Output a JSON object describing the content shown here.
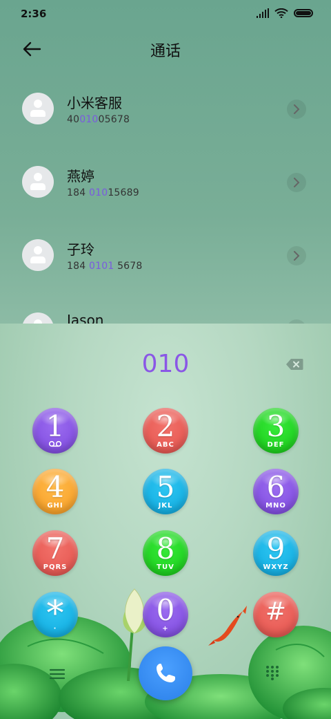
{
  "status_bar": {
    "time": "2:36"
  },
  "header": {
    "title": "通话"
  },
  "contacts": [
    {
      "name": "小米客服",
      "number_pre": "40",
      "number_hl": "010",
      "number_post": "05678"
    },
    {
      "name": "燕婷",
      "number_pre": "184 ",
      "number_hl": "010",
      "number_post": "15689"
    },
    {
      "name": "子玲",
      "number_pre": "184 ",
      "number_hl": "0101",
      "number_post": " 5678"
    },
    {
      "name": "Jason",
      "number_pre": "",
      "number_hl": "",
      "number_post": ""
    }
  ],
  "dialer": {
    "input": "010",
    "keys": [
      {
        "digit": "1",
        "letters": "",
        "color": "#8752e4"
      },
      {
        "digit": "2",
        "letters": "ABC",
        "color": "#ea5e58"
      },
      {
        "digit": "3",
        "letters": "DEF",
        "color": "#22d822"
      },
      {
        "digit": "4",
        "letters": "GHI",
        "color": "#f9aa34"
      },
      {
        "digit": "5",
        "letters": "JKL",
        "color": "#18b4e6"
      },
      {
        "digit": "6",
        "letters": "MNO",
        "color": "#8752e4"
      },
      {
        "digit": "7",
        "letters": "PQRS",
        "color": "#ea5e58"
      },
      {
        "digit": "8",
        "letters": "TUV",
        "color": "#22d822"
      },
      {
        "digit": "9",
        "letters": "WXYZ",
        "color": "#18b4e6"
      },
      {
        "digit": "*",
        "letters": "·",
        "color": "#18b4e6"
      },
      {
        "digit": "0",
        "letters": "+",
        "color": "#8752e4"
      },
      {
        "digit": "#",
        "letters": "",
        "color": "#ea5e58"
      }
    ]
  },
  "icons": {
    "back": "arrow-left-icon",
    "voicemail": "voicemail-icon",
    "delete": "backspace-icon",
    "call": "phone-icon",
    "menu": "menu-icon",
    "dialpad": "dialpad-icon"
  }
}
